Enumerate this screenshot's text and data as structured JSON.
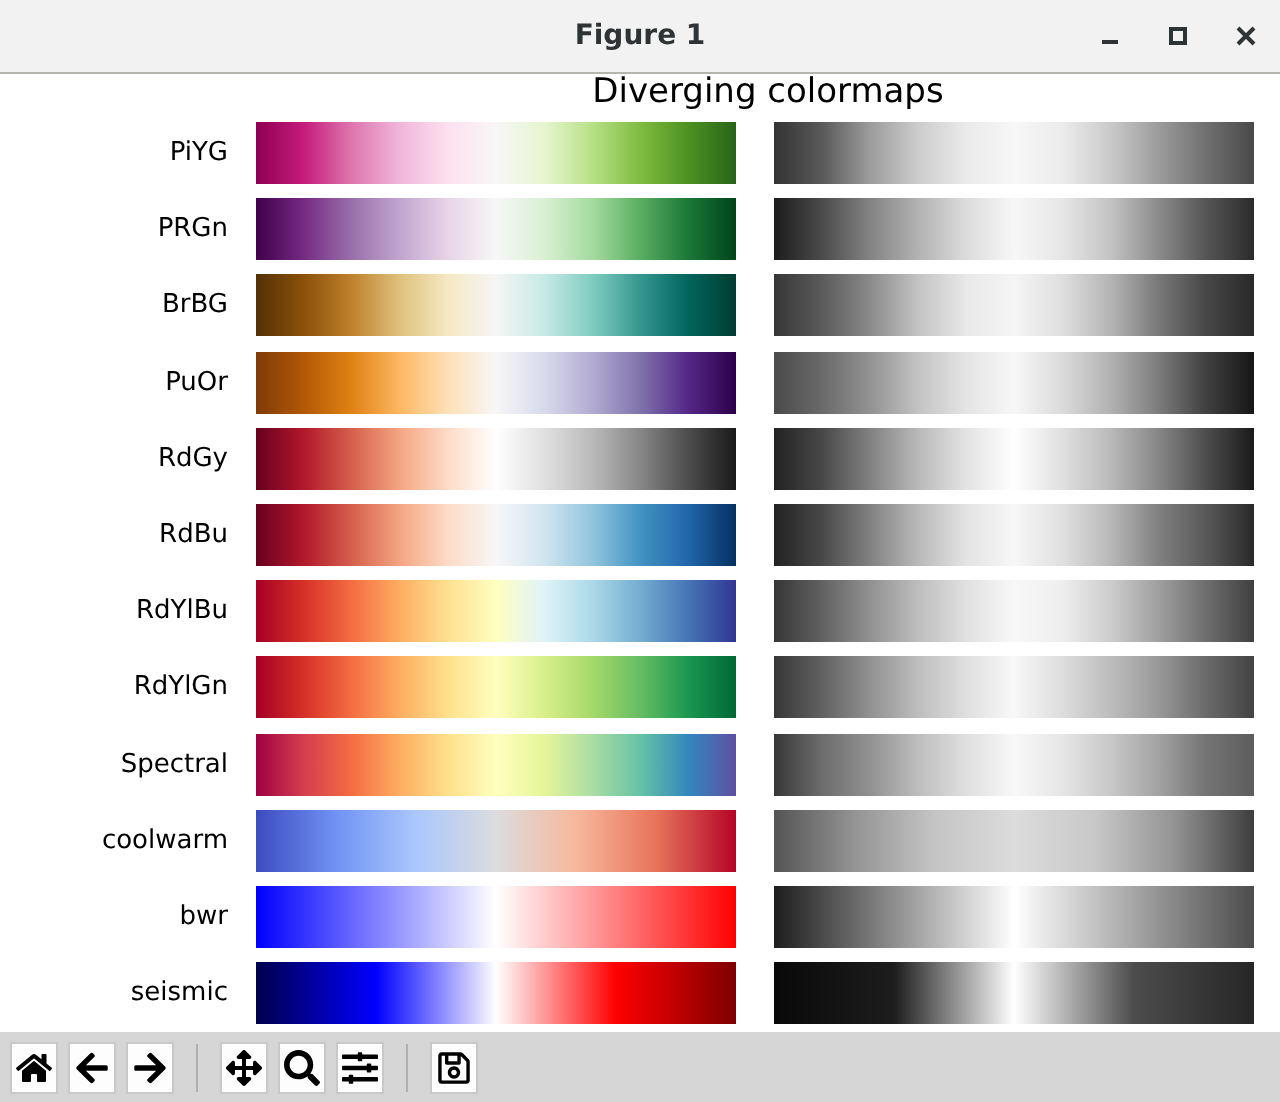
{
  "window": {
    "title": "Figure 1"
  },
  "figure": {
    "title": "Diverging colormaps",
    "colormaps": [
      {
        "name": "PiYG"
      },
      {
        "name": "PRGn"
      },
      {
        "name": "BrBG"
      },
      {
        "name": "PuOr"
      },
      {
        "name": "RdGy"
      },
      {
        "name": "RdBu"
      },
      {
        "name": "RdYlBu"
      },
      {
        "name": "RdYlGn"
      },
      {
        "name": "Spectral"
      },
      {
        "name": "coolwarm"
      },
      {
        "name": "bwr"
      },
      {
        "name": "seismic"
      }
    ]
  }
}
